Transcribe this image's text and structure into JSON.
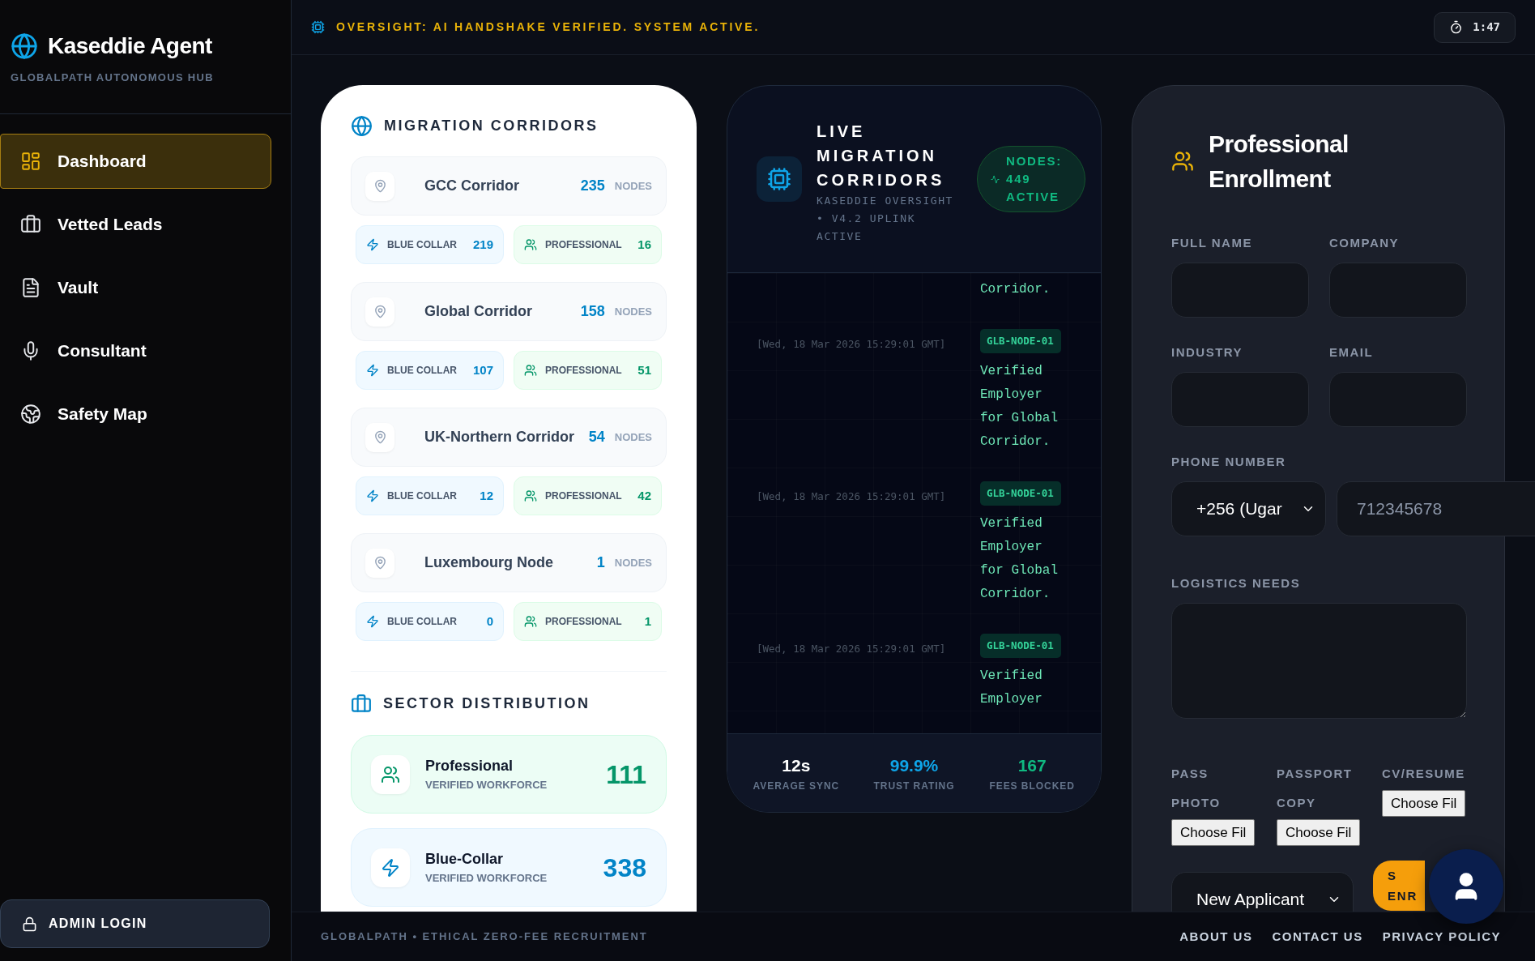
{
  "sidebar": {
    "brand": "Kaseddie Agent",
    "tagline": "GLOBALPATH AUTONOMOUS HUB",
    "items": [
      {
        "label": "Dashboard",
        "selected": true
      },
      {
        "label": "Vetted Leads",
        "selected": false
      },
      {
        "label": "Vault",
        "selected": false
      },
      {
        "label": "Consultant",
        "selected": false
      },
      {
        "label": "Safety Map",
        "selected": false
      }
    ],
    "admin_button": "ADMIN LOGIN"
  },
  "header": {
    "status": "OVERSIGHT: AI HANDSHAKE VERIFIED. SYSTEM ACTIVE.",
    "timer": "1:47"
  },
  "corridors_card": {
    "title": "MIGRATION CORRIDORS",
    "corridors": [
      {
        "name": "GCC Corridor",
        "count": "235",
        "unit": "NODES",
        "chips": [
          {
            "kind": "blue_collar",
            "label": "BLUE COLLAR",
            "value": "219"
          },
          {
            "kind": "professional",
            "label": "PROFESSIONAL",
            "value": "16"
          }
        ]
      },
      {
        "name": "Global Corridor",
        "count": "158",
        "unit": "NODES",
        "chips": [
          {
            "kind": "blue_collar",
            "label": "BLUE COLLAR",
            "value": "107"
          },
          {
            "kind": "professional",
            "label": "PROFESSIONAL",
            "value": "51"
          }
        ]
      },
      {
        "name": "UK-Northern Corridor",
        "count": "54",
        "unit": "NODES",
        "chips": [
          {
            "kind": "blue_collar",
            "label": "BLUE COLLAR",
            "value": "12"
          },
          {
            "kind": "professional",
            "label": "PROFESSIONAL",
            "value": "42"
          }
        ]
      },
      {
        "name": "Luxembourg Node",
        "count": "1",
        "unit": "NODES",
        "chips": [
          {
            "kind": "blue_collar",
            "label": "BLUE COLLAR",
            "value": "0"
          },
          {
            "kind": "professional",
            "label": "PROFESSIONAL",
            "value": "1"
          }
        ]
      }
    ],
    "sector_title": "SECTOR DISTRIBUTION",
    "sectors": [
      {
        "kind": "professional",
        "name": "Professional",
        "caption": "VERIFIED WORKFORCE",
        "value": "111"
      },
      {
        "kind": "blue_collar",
        "name": "Blue-Collar",
        "caption": "VERIFIED WORKFORCE",
        "value": "338"
      }
    ]
  },
  "live_card": {
    "title": "LIVE MIGRATION CORRIDORS",
    "subtitle": "KASEDDIE OVERSIGHT • V4.2 UPLINK ACTIVE",
    "badge": "NODES: 449 ACTIVE",
    "log": [
      {
        "message": "Corridor."
      },
      {
        "time": "[Wed, 18 Mar 2026 15:29:01 GMT]",
        "node": "GLB-NODE-01",
        "message": "Verified Employer for Global Corridor."
      },
      {
        "time": "[Wed, 18 Mar 2026 15:29:01 GMT]",
        "node": "GLB-NODE-01",
        "message": "Verified Employer for Global Corridor."
      },
      {
        "time": "[Wed, 18 Mar 2026 15:29:01 GMT]",
        "node": "GLB-NODE-01",
        "message": "Verified Employer"
      }
    ],
    "stats": [
      {
        "value": "12s",
        "label": "AVERAGE SYNC",
        "color": "#ffffff"
      },
      {
        "value": "99.9%",
        "label": "TRUST RATING",
        "color": "#0ea5e9"
      },
      {
        "value": "167",
        "label": "FEES BLOCKED",
        "color": "#10b981"
      }
    ]
  },
  "enrollment": {
    "title": "Professional Enrollment",
    "fields": [
      {
        "label": "FULL NAME"
      },
      {
        "label": "COMPANY"
      },
      {
        "label": "INDUSTRY"
      },
      {
        "label": "EMAIL"
      }
    ],
    "phone": {
      "label": "PHONE NUMBER",
      "code": "+256 (Ugar",
      "placeholder": "712345678"
    },
    "logistics": {
      "label": "LOGISTICS NEEDS"
    },
    "uploads": [
      {
        "label": "PASS PHOTO",
        "button": "Choose Fil"
      },
      {
        "label": "PASSPORT COPY",
        "button": "Choose Fil"
      },
      {
        "label": "CV/RESUME",
        "button": "Choose Fil"
      }
    ],
    "applicant_type": "New Applicant",
    "submit_button": "S ENR"
  },
  "footer": {
    "text": "GLOBALPATH • ETHICAL ZERO-FEE RECRUITMENT",
    "links": [
      "ABOUT US",
      "CONTACT US",
      "PRIVACY POLICY"
    ]
  }
}
